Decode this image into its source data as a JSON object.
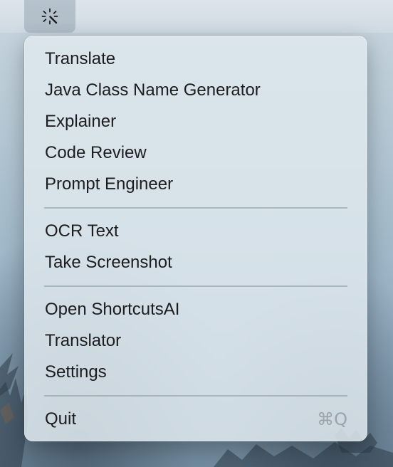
{
  "menubar": {
    "status_icon": "sparkle-wand-icon"
  },
  "menu": {
    "groups": [
      {
        "items": [
          {
            "label": "Translate"
          },
          {
            "label": "Java Class Name Generator"
          },
          {
            "label": "Explainer"
          },
          {
            "label": "Code Review"
          },
          {
            "label": "Prompt Engineer"
          }
        ]
      },
      {
        "items": [
          {
            "label": "OCR Text"
          },
          {
            "label": "Take Screenshot"
          }
        ]
      },
      {
        "items": [
          {
            "label": "Open ShortcutsAI"
          },
          {
            "label": "Translator"
          },
          {
            "label": "Settings"
          }
        ]
      },
      {
        "items": [
          {
            "label": "Quit",
            "shortcut": "⌘Q"
          }
        ]
      }
    ]
  }
}
